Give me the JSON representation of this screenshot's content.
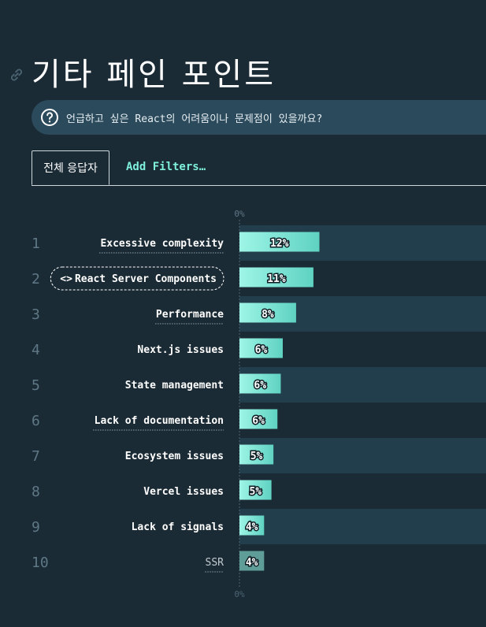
{
  "page": {
    "title": "기타 페인 포인트",
    "question": "언급하고 싶은 React의 어려움이나 문제점이 있을까요?",
    "tabs": [
      {
        "label": "전체 응답자",
        "active": true
      },
      {
        "label": "Add Filters…",
        "active": false
      }
    ],
    "icons": {
      "title_link": "link-icon",
      "question": "question-circle-icon",
      "row_tag": "code-brackets-icon"
    },
    "colors": {
      "background": "#1b2b35",
      "row_band": "#223d4c",
      "bar_start": "#9ef5e6",
      "bar_end": "#5fd2c2",
      "bar_muted": "#5f9e98",
      "accent": "#7ef0dc"
    }
  },
  "chart_data": {
    "type": "bar",
    "orientation": "horizontal",
    "title": "",
    "xlabel": "",
    "ylabel": "",
    "x_tick_label": "0%",
    "xlim": [
      0,
      37
    ],
    "categories": [
      "Excessive complexity",
      "React Server Components",
      "Performance",
      "Next.js issues",
      "State management",
      "Lack of documentation",
      "Ecosystem issues",
      "Vercel issues",
      "Lack of signals",
      "SSR"
    ],
    "ranks": [
      "1",
      "2",
      "3",
      "4",
      "5",
      "6",
      "7",
      "8",
      "9",
      "10"
    ],
    "values": [
      12,
      11,
      8,
      6,
      6,
      6,
      5,
      5,
      4,
      4
    ],
    "value_labels": [
      "12%",
      "11%",
      "8%",
      "6%",
      "6%",
      "6%",
      "5%",
      "5%",
      "4%",
      "4%"
    ],
    "bar_values": [
      12.0,
      11.1,
      8.5,
      6.5,
      6.2,
      5.7,
      5.1,
      4.8,
      3.7,
      3.7
    ],
    "highlighted": [
      false,
      true,
      false,
      false,
      false,
      false,
      false,
      false,
      false,
      false
    ],
    "underlined": [
      true,
      false,
      true,
      false,
      false,
      true,
      false,
      false,
      false,
      true
    ],
    "muted": [
      false,
      false,
      false,
      false,
      false,
      false,
      false,
      false,
      false,
      true
    ],
    "grid": false,
    "legend": "none"
  }
}
